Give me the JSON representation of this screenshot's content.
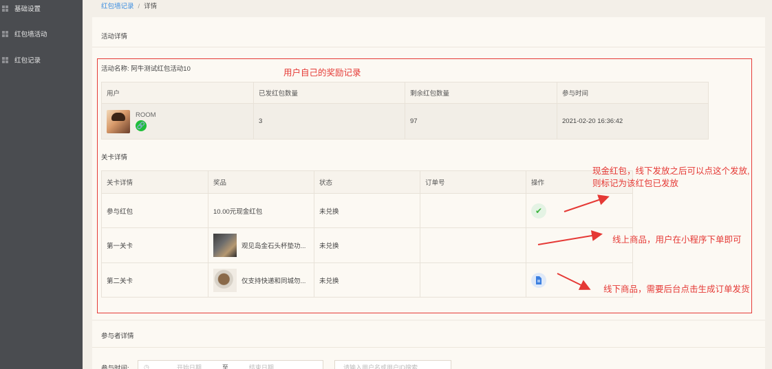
{
  "sidebar": {
    "items": [
      {
        "label": "基础设置",
        "icon": "grid-icon"
      },
      {
        "label": "红包墙活动",
        "icon": "grid-icon"
      },
      {
        "label": "红包记录",
        "icon": "grid-icon"
      }
    ]
  },
  "breadcrumb": {
    "parent": "红包墙记录",
    "separator": "/",
    "current": "详情"
  },
  "activity": {
    "panel_title": "活动详情",
    "name": "活动名称: 阿牛测试红包活动10",
    "user_table": {
      "headers": [
        "用户",
        "已发红包数量",
        "剩余红包数量",
        "参与时间"
      ],
      "row": {
        "user_name": "ROOM",
        "sent": "3",
        "remaining": "97",
        "time": "2021-02-20 16:36:42"
      }
    },
    "level_title": "关卡详情",
    "level_table": {
      "headers": [
        "关卡详情",
        "奖品",
        "状态",
        "订单号",
        "操作"
      ],
      "rows": [
        {
          "level": "参与红包",
          "prize": "10.00元现金红包",
          "status": "未兑换",
          "order": "",
          "op": "check-icon"
        },
        {
          "level": "第一关卡",
          "prize": "观见岛金石头杯垫功...",
          "status": "未兑换",
          "order": "",
          "op": ""
        },
        {
          "level": "第二关卡",
          "prize": "仅支持快递和同城勿...",
          "status": "未兑换",
          "order": "",
          "op": "document-icon"
        }
      ]
    }
  },
  "annotations": {
    "box_title": "用户自己的奖励记录",
    "cash_line1": "现金红包，线下发放之后可以点这个发放,",
    "cash_line2": "则标记为该红包已发放",
    "online": "线上商品，用户在小程序下单即可",
    "offline": "线下商品，需要后台点击生成订单发货",
    "color": "#e53935"
  },
  "participants": {
    "panel_title": "参与者详情",
    "time_label": "参与时间:",
    "start_placeholder": "开始日期",
    "to": "至",
    "end_placeholder": "结束日期",
    "search_placeholder": "请输入用户名或用户ID搜索"
  }
}
